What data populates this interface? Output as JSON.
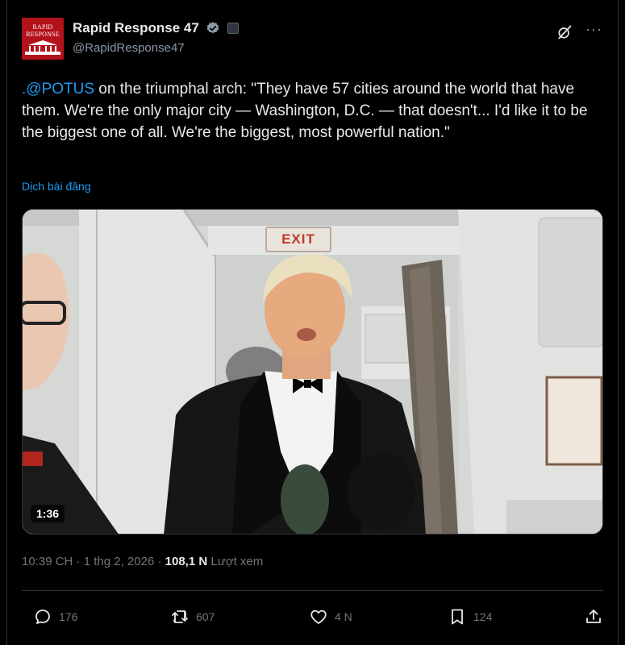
{
  "account": {
    "display_name": "Rapid Response 47",
    "handle": "@RapidResponse47",
    "avatar_text": "RAPID RESPONSE",
    "avatar_color": "#b3121b"
  },
  "tweet": {
    "mention": ".@POTUS",
    "body": " on the triumphal arch: \"They have 57 cities around the world that have them. We're the only major city — Washington, D.C. — that doesn't... I'd like it to be the biggest one of all. We're the biggest, most powerful nation.\"",
    "translate_label": "Dịch bài đăng"
  },
  "media": {
    "exit_sign": "EXIT",
    "duration": "1:36"
  },
  "meta": {
    "time": "10:39 CH",
    "date": "1 thg 2, 2026",
    "views_count": "108,1 N",
    "views_label": "Lượt xem",
    "sep": "·"
  },
  "actions": {
    "replies": "176",
    "reposts": "607",
    "likes": "4 N",
    "bookmarks": "124"
  },
  "colors": {
    "accent": "#1d9bf0",
    "background": "#000000",
    "muted": "#71767b"
  }
}
